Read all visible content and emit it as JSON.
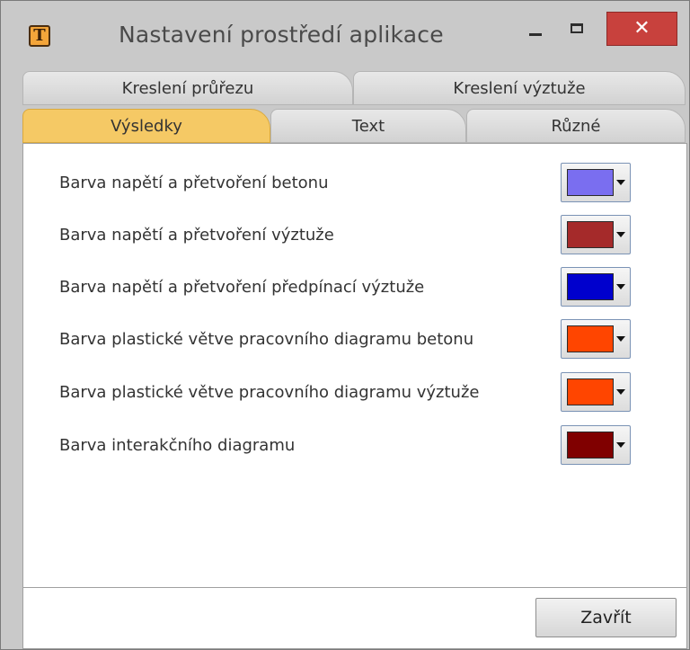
{
  "window": {
    "title": "Nastavení prostředí aplikace",
    "icon": "app-t-icon",
    "icon_glyph": "T",
    "close_glyph": "✕"
  },
  "tabs_row1": [
    {
      "label": "Kreslení průřezu"
    },
    {
      "label": "Kreslení výztuže"
    }
  ],
  "tabs_row2": [
    {
      "label": "Výsledky",
      "active": true
    },
    {
      "label": "Text"
    },
    {
      "label": "Různé"
    }
  ],
  "settings": [
    {
      "label": "Barva napětí a přetvoření betonu",
      "color": "#7a6ef0"
    },
    {
      "label": "Barva napětí a přetvoření výztuže",
      "color": "#a52a2a"
    },
    {
      "label": "Barva napětí a přetvoření předpínací výztuže",
      "color": "#0000cd"
    },
    {
      "label": "Barva plastické větve pracovního diagramu betonu",
      "color": "#ff4500"
    },
    {
      "label": "Barva plastické větve pracovního diagramu výztuže",
      "color": "#ff4500"
    },
    {
      "label": "Barva interakčního diagramu",
      "color": "#800000"
    }
  ],
  "footer": {
    "close_label": "Zavřít"
  },
  "colors": {
    "active_tab": "#f5c965",
    "close_button": "#c8413d"
  }
}
